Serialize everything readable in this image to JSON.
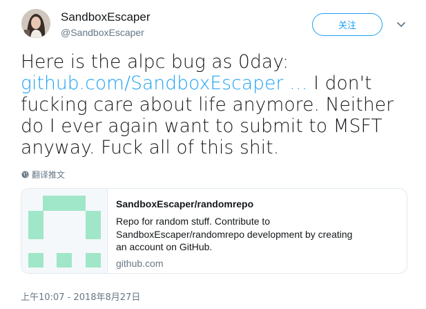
{
  "user": {
    "display_name": "SandboxEscaper",
    "handle": "@SandboxEscaper"
  },
  "follow_button": {
    "label": "关注"
  },
  "tweet": {
    "text_before_link": "Here is the alpc bug as 0day: ",
    "link_text": "github.com/SandboxEscaper …",
    "text_after_link": " I don't fucking care about life anymore. Neither do I ever again want to submit to MSFT anyway. Fuck all of this shit."
  },
  "translate": {
    "label": "翻译推文"
  },
  "card": {
    "title": "SandboxEscaper/randomrepo",
    "description": "Repo for random stuff. Contribute to SandboxEscaper/randomrepo development by creating an account on GitHub.",
    "domain": "github.com",
    "thumb_color": "#a0e6c9"
  },
  "timestamp": "上午10:07 - 2018年8月27日",
  "icons": {
    "caret": "chevron-down-icon",
    "globe": "globe-icon"
  },
  "colors": {
    "accent": "#1da1f2",
    "secondary_text": "#657786",
    "text": "#14171a",
    "border": "#e1e8ed"
  }
}
